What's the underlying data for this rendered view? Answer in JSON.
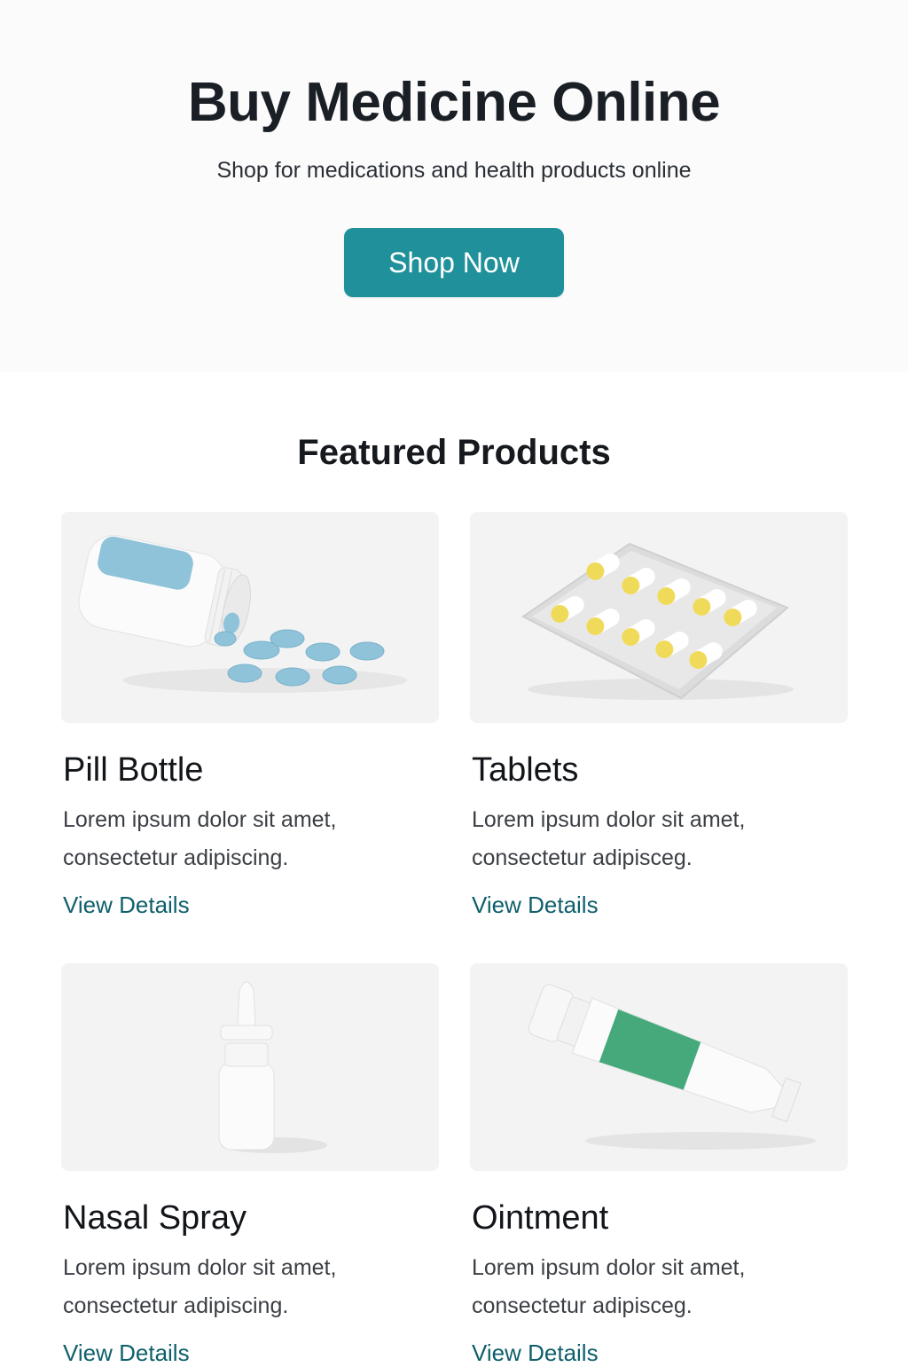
{
  "hero": {
    "title": "Buy Medicine Online",
    "subtitle": "Shop for medications and health products online",
    "cta_label": "Shop Now"
  },
  "featured": {
    "heading": "Featured Products",
    "products": [
      {
        "name": "Pill Bottle",
        "description": "Lorem ipsum dolor sit amet, consectetur adipiscing.",
        "link_label": "View Details",
        "image": "pill-bottle-image"
      },
      {
        "name": "Tablets",
        "description": "Lorem ipsum dolor sit amet, consectetur adipisceg.",
        "link_label": "View Details",
        "image": "blister-pack-image"
      },
      {
        "name": "Nasal Spray",
        "description": "Lorem ipsum dolor sit amet, consectetur adipiscing.",
        "link_label": "View Details",
        "image": "nasal-spray-image"
      },
      {
        "name": "Ointment",
        "description": "Lorem ipsum dolor sit amet, consectetur adipisceg.",
        "link_label": "View Details",
        "image": "ointment-tube-image"
      }
    ]
  },
  "colors": {
    "accent": "#20919b",
    "link": "#0e5f6b",
    "hero_background": "#fbfbfc",
    "card_image_background": "#f3f3f3"
  }
}
